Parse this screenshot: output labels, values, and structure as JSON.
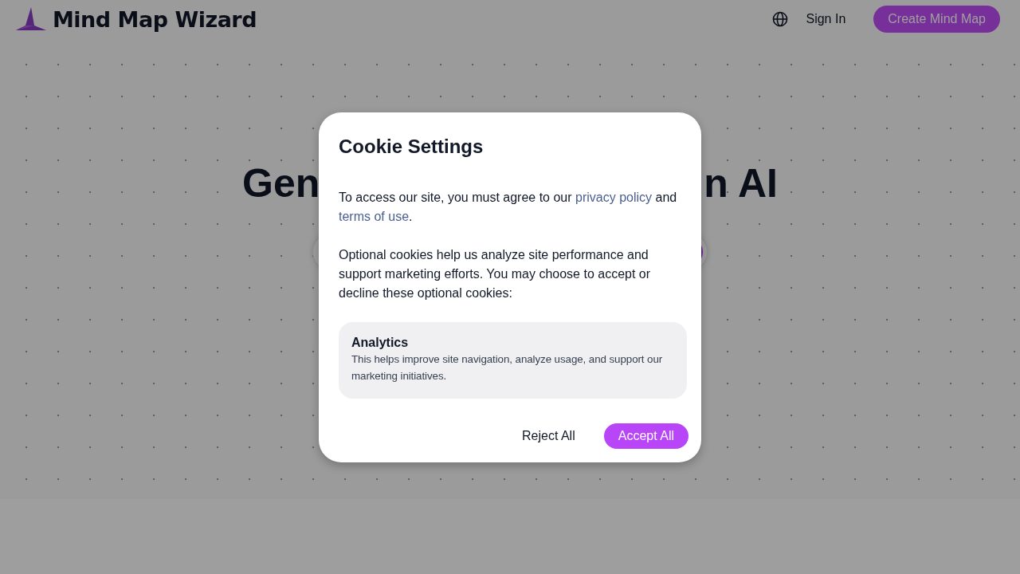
{
  "header": {
    "brand": "Mind Map Wizard",
    "nav": [
      {
        "kind": "language"
      },
      {
        "kind": "link",
        "label": "Sign In"
      },
      {
        "kind": "primary",
        "label": "Create Mind Map"
      }
    ]
  },
  "hero": {
    "heading_left": "Gen",
    "heading_right": "n AI"
  },
  "cookie_dialog": {
    "title": "Cookie Settings",
    "intro": "To access our site, you must agree to our ",
    "privacy_link": "privacy policy",
    "intro_mid": " and ",
    "terms_link": "terms of use",
    "intro_end": ".",
    "body": "Optional cookies help us analyze site performance and support marketing efforts. You may choose to accept or decline these optional cookies:",
    "categories": [
      {
        "title": "Analytics",
        "description": "This helps improve site navigation, analyze usage, and support our marketing initiatives."
      }
    ],
    "buttons": [
      {
        "kind": "plain",
        "label": "Reject All"
      },
      {
        "kind": "primary",
        "label": "Accept All"
      }
    ]
  }
}
